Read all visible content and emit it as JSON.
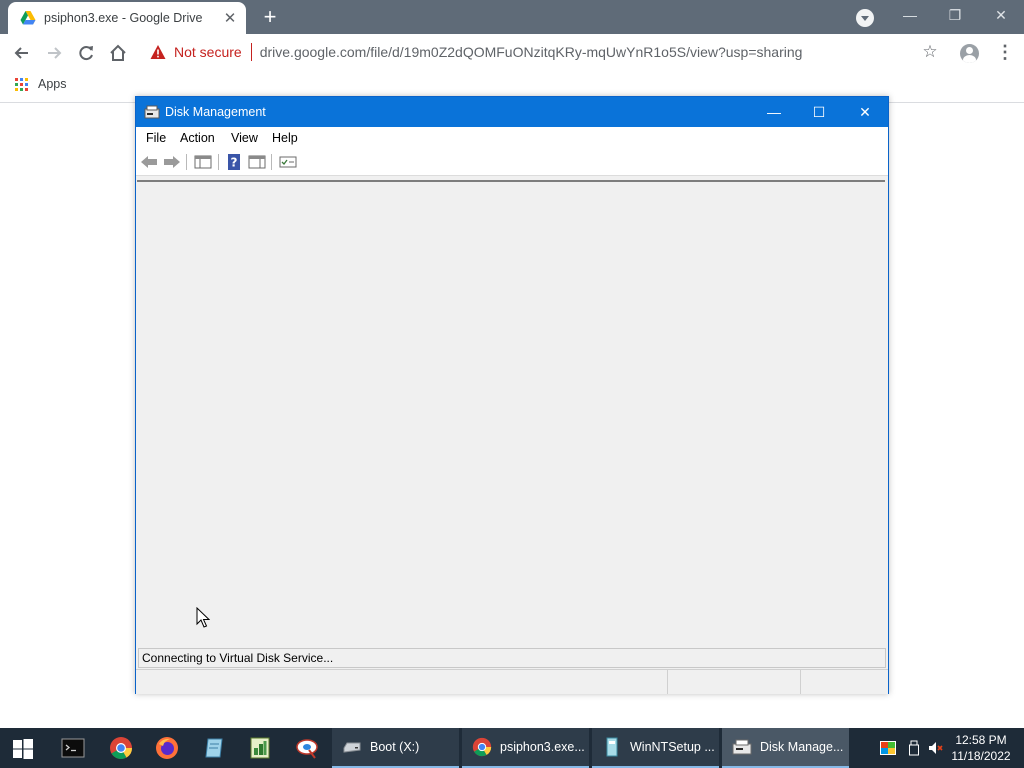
{
  "browser": {
    "tab_title": "psiphon3.exe - Google Drive",
    "new_tab_symbol": "+",
    "security_label": "Not secure",
    "url": "drive.google.com/file/d/19m0Z2dQOMFuONzitqKRy-mqUwYnR1o5S/view?usp=sharing",
    "bookmark_apps": "Apps",
    "window_controls": {
      "minimize": "—",
      "restore": "❐",
      "close": "✕"
    },
    "icons": [
      "google-drive-icon",
      "back-arrow-icon",
      "forward-arrow-icon",
      "reload-icon",
      "home-icon",
      "warning-icon",
      "star-icon",
      "profile-icon",
      "menu-dots-icon",
      "apps-grid-icon"
    ]
  },
  "disk_management": {
    "title": "Disk Management",
    "menu": [
      "File",
      "Action",
      "View",
      "Help"
    ],
    "status_text": "Connecting to Virtual Disk Service...",
    "window_controls": {
      "minimize": "—",
      "maximize": "☐",
      "close": "✕"
    }
  },
  "taskbar": {
    "tasks": [
      {
        "label": "Boot (X:)"
      },
      {
        "label": "psiphon3.exe..."
      },
      {
        "label": "WinNTSetup ..."
      },
      {
        "label": "Disk Manage..."
      }
    ],
    "clock": {
      "time": "12:58 PM",
      "date": "11/18/2022"
    }
  },
  "colors": {
    "chrome_frame": "#5f6b78",
    "titlebar_blue": "#0a73d9",
    "taskbar": "#1e2b38",
    "warning_red": "#c5221f"
  }
}
